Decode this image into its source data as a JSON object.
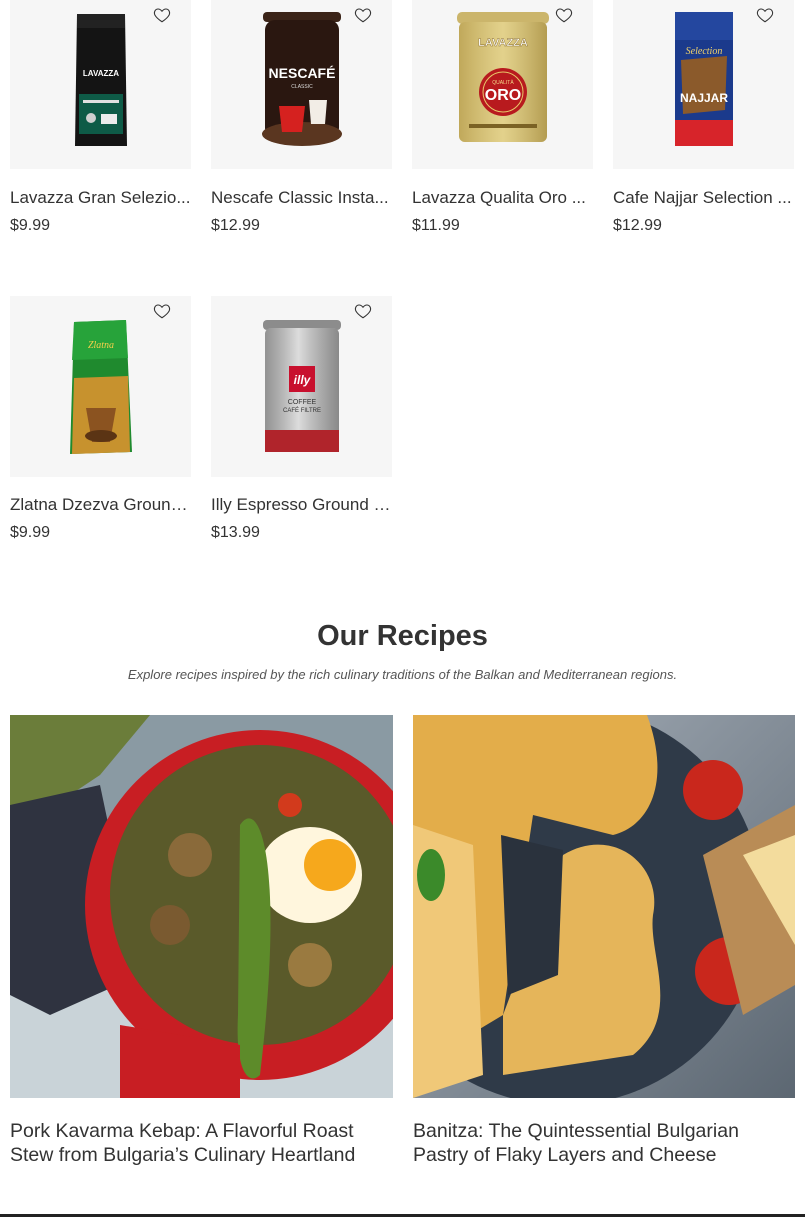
{
  "products": [
    {
      "name": "Lavazza Gran Selezio...",
      "price": "$9.99",
      "image": "coffee-bag-lavazza"
    },
    {
      "name": "Nescafe Classic Insta...",
      "price": "$12.99",
      "image": "coffee-tin-nescafe"
    },
    {
      "name": "Lavazza Qualita Oro ...",
      "price": "$11.99",
      "image": "coffee-tin-lavazza-oro"
    },
    {
      "name": "Cafe Najjar Selection ...",
      "price": "$12.99",
      "image": "coffee-bag-najjar"
    },
    {
      "name": "Zlatna Dzezva Ground...",
      "price": "$9.99",
      "image": "coffee-bag-zlatna"
    },
    {
      "name": "Illy Espresso Ground c...",
      "price": "$13.99",
      "image": "coffee-tin-illy"
    }
  ],
  "labels": {
    "lavazza": "LAVAZZA",
    "nescafe": "NESCAFÉ",
    "nescafe_sub": "CLASSIC",
    "oro_brand": "LAVAZZA",
    "oro_quality": "QUALITÀ",
    "oro": "ORO",
    "najjar": "NAJJAR",
    "najjar_script": "Selection",
    "zlatna": "Zlatna",
    "illy": "illy",
    "illy_sub1": "COFFEE",
    "illy_sub2": "CAFÉ FILTRE"
  },
  "recipes_section": {
    "title": "Our Recipes",
    "subtitle": "Explore recipes inspired by the rich culinary traditions of the Balkan and Mediterranean regions."
  },
  "recipes": [
    {
      "title": "Pork Kavarma Kebap: A Flavorful Roast Stew from Bulgaria’s Culinary Heartland",
      "image": "kavarma-dish-photo"
    },
    {
      "title": "Banitza: The Quintessential Bulgarian Pastry of Flaky Layers and Cheese",
      "image": "banitza-pastry-photo"
    }
  ],
  "colors": {
    "heart_stroke": "#333333",
    "thumb_bg": "#f6f6f6",
    "text": "#333333"
  }
}
